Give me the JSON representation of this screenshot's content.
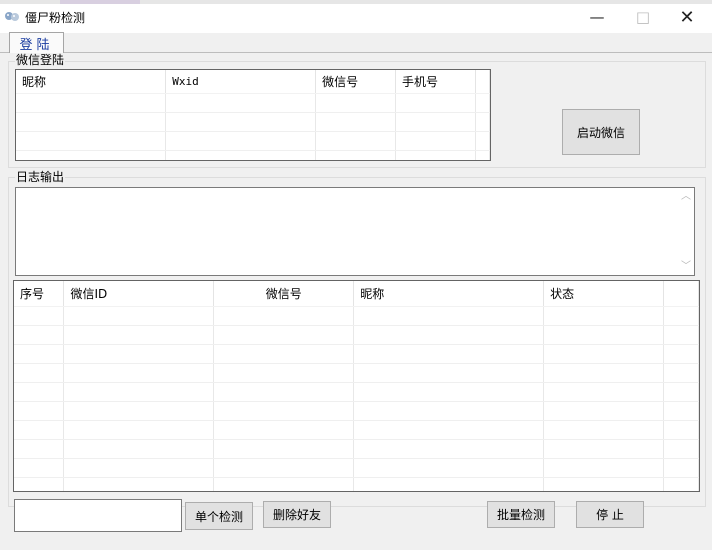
{
  "window": {
    "title": "僵尸粉检测",
    "minimize_glyph": "—",
    "maximize_glyph": "□",
    "close_glyph": "✕",
    "icon": "app-icon"
  },
  "tabs": [
    {
      "label": "登陆",
      "selected": true
    }
  ],
  "wechat_login": {
    "group_label": "微信登陆",
    "columns": [
      "昵称",
      "Wxid",
      "微信号",
      "手机号"
    ],
    "start_button": "启动微信"
  },
  "log_output": {
    "group_label": "日志输出",
    "text": ""
  },
  "results_table": {
    "columns": [
      "序号",
      "微信ID",
      "微信号",
      "昵称",
      "状态"
    ]
  },
  "bottom_bar": {
    "input_value": "",
    "single_check_button": "单个检测",
    "delete_friend_button": "删除好友",
    "batch_check_button": "批量检测",
    "stop_button": "停 止"
  },
  "colors": {
    "tab_text": "#1a3ca0",
    "window_bg": "#f0f0f0"
  }
}
